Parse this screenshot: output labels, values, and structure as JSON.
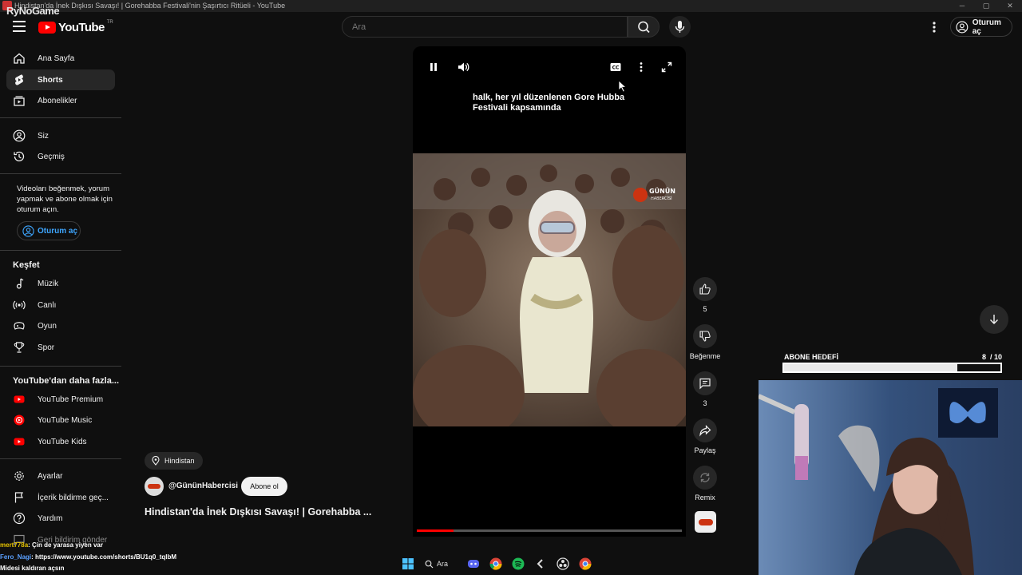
{
  "window": {
    "title": "Hindistan'da İnek Dışkısı Savaşı! | Gorehabba Festivali'nin Şaşırtıcı Ritüeli - YouTube",
    "overlay_brand": "RyNoGame"
  },
  "header": {
    "logo_text": "YouTube",
    "logo_region": "TR",
    "search_placeholder": "Ara",
    "signin_label": "Oturum aç"
  },
  "sidebar": {
    "main": [
      {
        "label": "Ana Sayfa",
        "icon": "home-icon"
      },
      {
        "label": "Shorts",
        "icon": "shorts-icon",
        "active": true
      },
      {
        "label": "Abonelikler",
        "icon": "subscriptions-icon"
      }
    ],
    "you": [
      {
        "label": "Siz",
        "icon": "user-icon"
      },
      {
        "label": "Geçmiş",
        "icon": "history-icon"
      }
    ],
    "signin_note": "Videoları beğenmek, yorum yapmak ve abone olmak için oturum açın.",
    "signin_button": "Oturum aç",
    "explore_heading": "Keşfet",
    "explore": [
      {
        "label": "Müzik",
        "icon": "music-icon"
      },
      {
        "label": "Canlı",
        "icon": "live-icon"
      },
      {
        "label": "Oyun",
        "icon": "gaming-icon"
      },
      {
        "label": "Spor",
        "icon": "trophy-icon"
      }
    ],
    "more_heading": "YouTube'dan daha fazla...",
    "more": [
      {
        "label": "YouTube Premium",
        "icon": "youtube-premium-icon"
      },
      {
        "label": "YouTube Music",
        "icon": "youtube-music-icon"
      },
      {
        "label": "YouTube Kids",
        "icon": "youtube-kids-icon"
      }
    ],
    "footer": [
      {
        "label": "Ayarlar",
        "icon": "settings-icon"
      },
      {
        "label": "İçerik bildirme geç...",
        "icon": "flag-icon"
      },
      {
        "label": "Yardım",
        "icon": "help-icon"
      },
      {
        "label": "Geri bildirim gönder",
        "icon": "feedback-icon"
      }
    ]
  },
  "player": {
    "caption": "halk, her yıl düzenlenen Gore Hubba Festivali kapsamında",
    "watermark": "GÜNÜN HABERCİSİ",
    "progress": 0.14
  },
  "actions": {
    "like_count": "5",
    "dislike_label": "Beğenme",
    "comment_count": "3",
    "share_label": "Paylaş",
    "remix_label": "Remix"
  },
  "meta": {
    "location": "Hindistan",
    "channel": "@GününHabercisi",
    "subscribe_label": "Abone ol",
    "title": "Hindistan'da İnek Dışkısı Savaşı! | Gorehabba ..."
  },
  "stream": {
    "goal_label": "ABONE HEDEFİ",
    "goal_current": "8",
    "goal_total": "/ 10",
    "goal_fraction": 0.8
  },
  "chat": [
    {
      "user": "mert778a",
      "text": ": Çin de yarasa yiyen var"
    },
    {
      "user": "Fero_Nagi",
      "text": ": https://www.youtube.com/shorts/BU1q0_tqlbM"
    },
    {
      "user": "",
      "text": "Midesi kaldıran açsın"
    }
  ],
  "taskbar": {
    "search_label": "Ara"
  },
  "colors": {
    "background": "#0f0f0f",
    "accent_red": "#ff0000",
    "link_blue": "#3ea6ff"
  }
}
